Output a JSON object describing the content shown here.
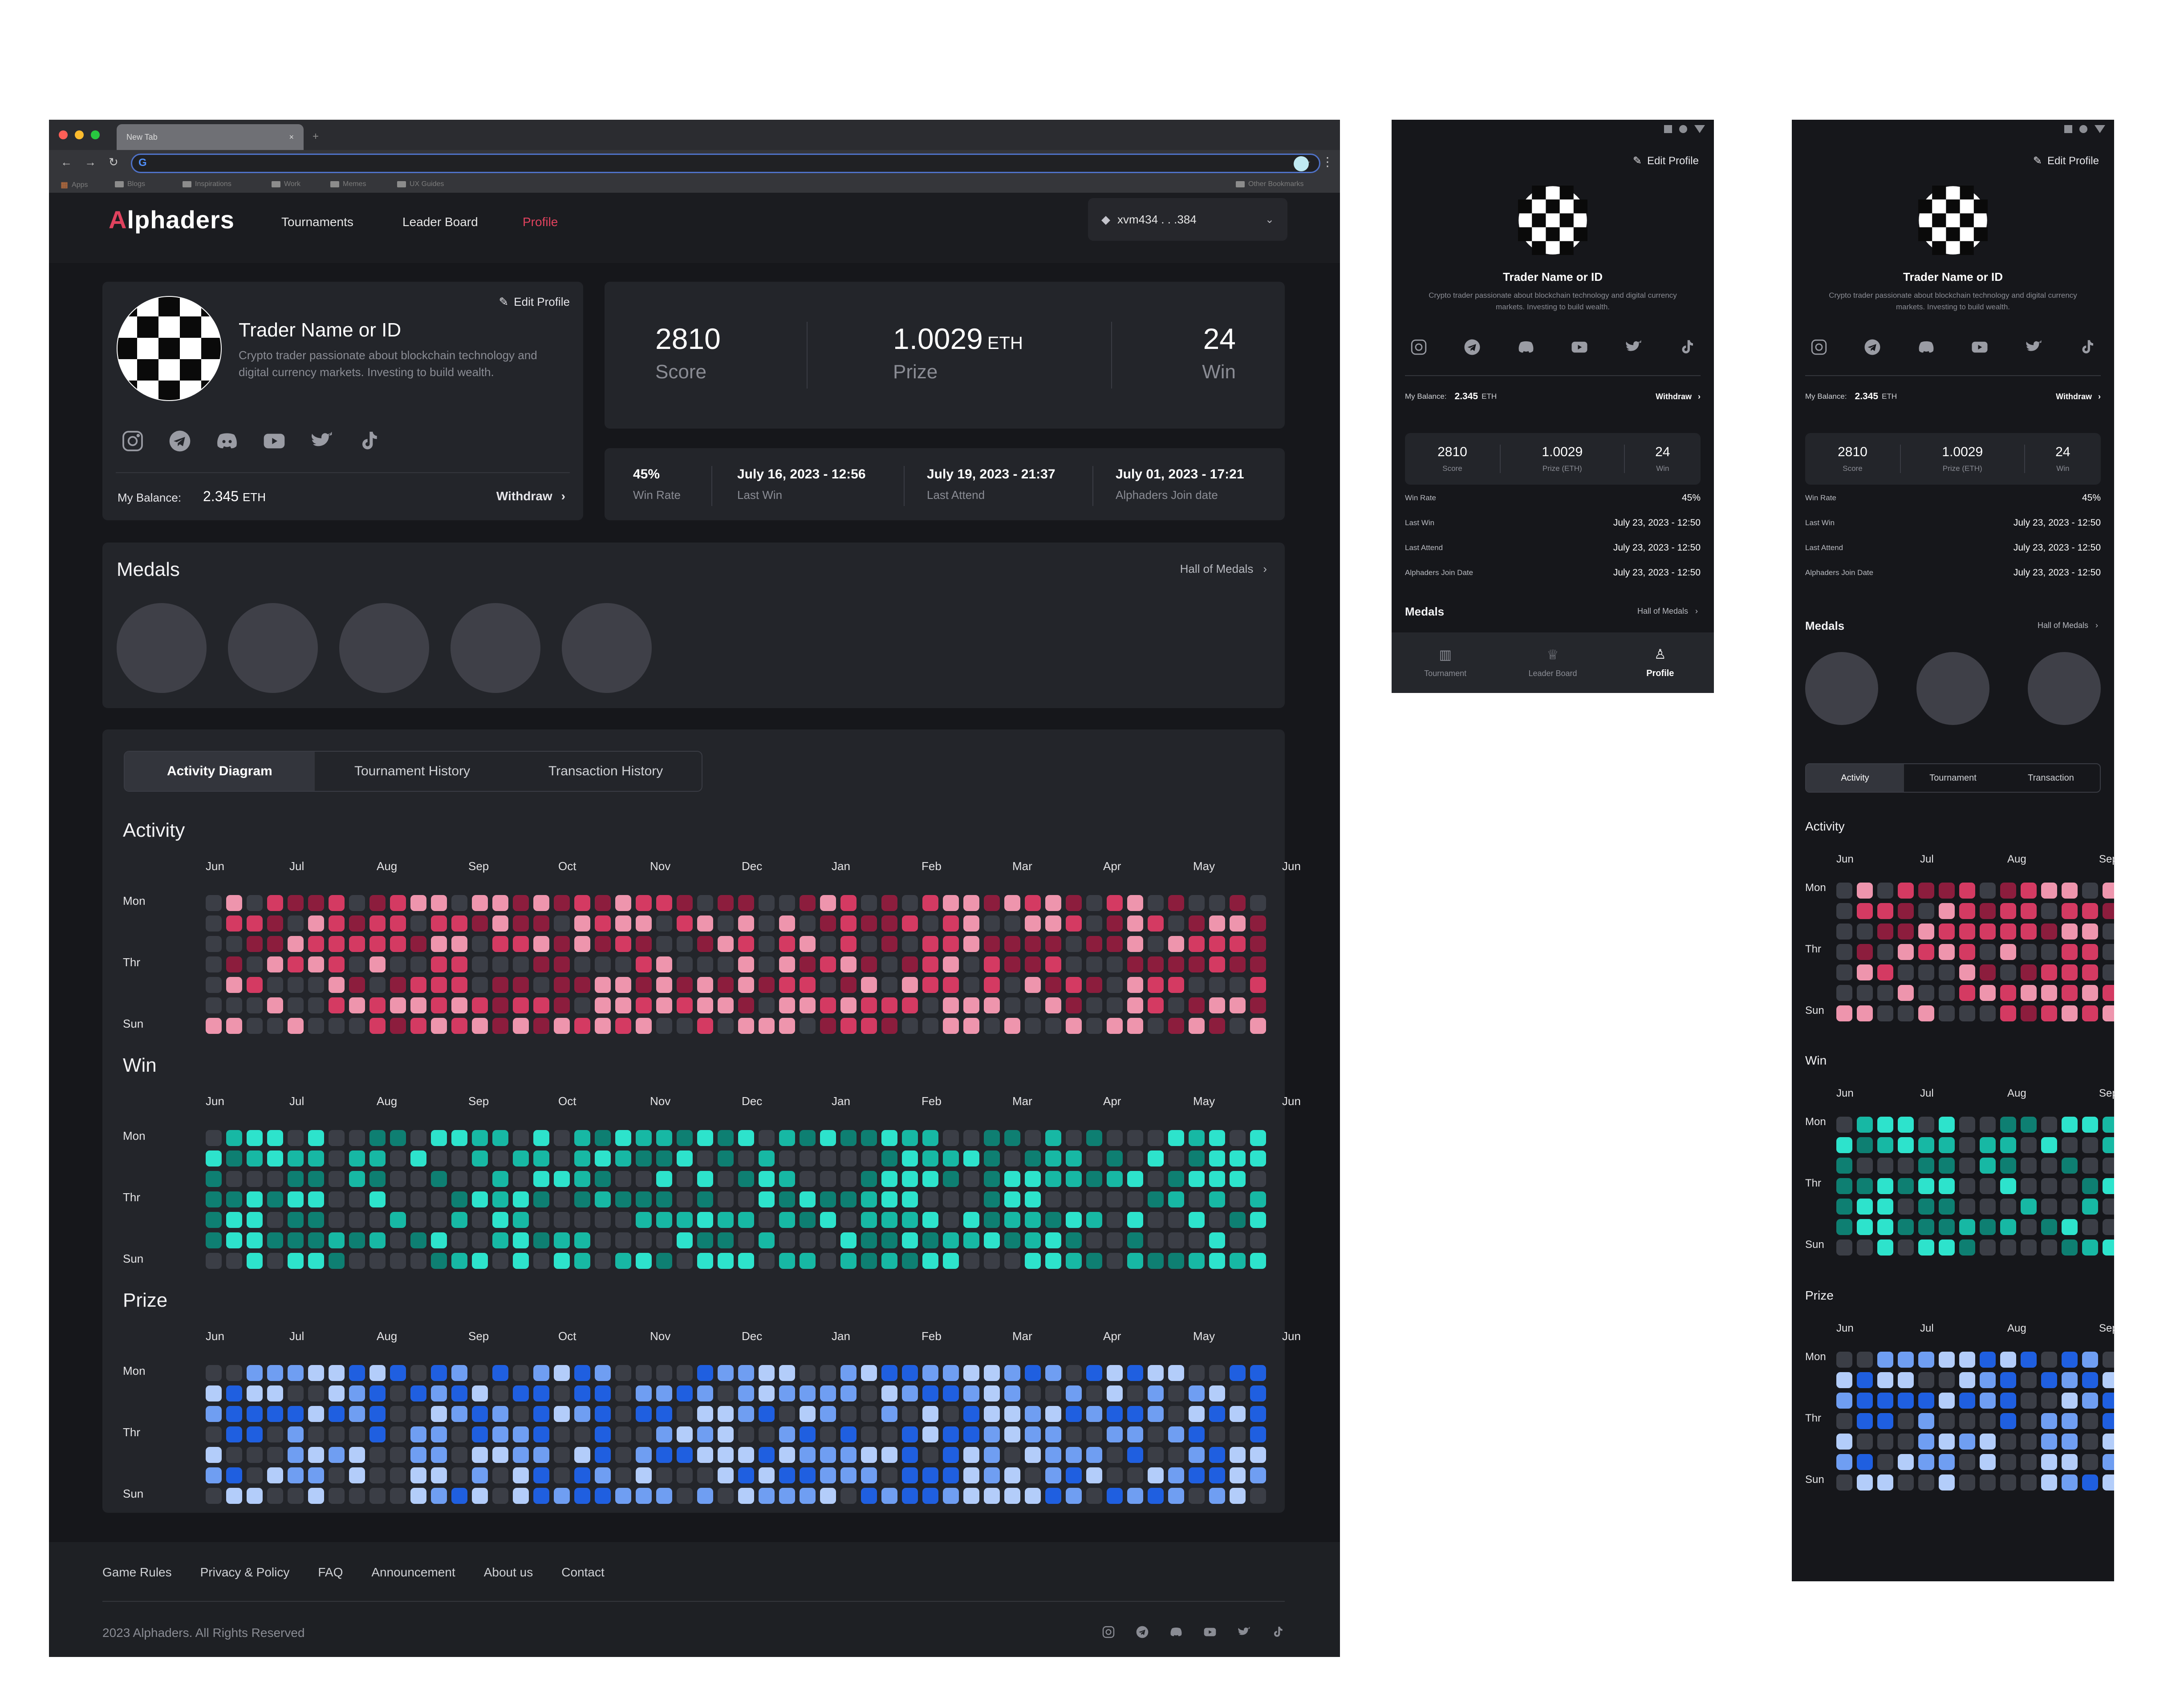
{
  "browser": {
    "tab_title": "New Tab",
    "tab_close": "×",
    "new_tab": "+",
    "bookmarks": [
      "Apps",
      "Blogs",
      "Inspirations",
      "Work",
      "Memes",
      "UX Guides"
    ],
    "other_bookmarks": "Other Bookmarks"
  },
  "nav": {
    "logo_a": "A",
    "logo_rest": "lphaders",
    "links": [
      "Tournaments",
      "Leader Board",
      "Profile"
    ],
    "active_color": "#e0425e",
    "wallet_address": "xvm434 . . .384"
  },
  "profile": {
    "name": "Trader Name or ID",
    "bio": "Crypto trader passionate about blockchain technology and digital currency markets. Investing to build wealth.",
    "edit_label": "Edit Profile",
    "balance_label": "My Balance:",
    "balance_value": "2.345",
    "balance_unit": "ETH",
    "withdraw_label": "Withdraw",
    "socials": [
      "instagram-icon",
      "telegram-icon",
      "discord-icon",
      "youtube-icon",
      "twitter-icon",
      "tiktok-icon"
    ]
  },
  "stats": {
    "score": "2810",
    "score_label": "Score",
    "prize": "1.0029",
    "prize_unit": "ETH",
    "prize_label": "Prize",
    "win": "24",
    "win_label": "Win"
  },
  "details": {
    "win_rate": "45%",
    "win_rate_label": "Win Rate",
    "last_win": "July 16, 2023 - 12:56",
    "last_win_label": "Last Win",
    "last_attend": "July 19, 2023 - 21:37",
    "last_attend_label": "Last Attend",
    "join_date": "July 01, 2023 - 17:21",
    "join_label": "Alphaders Join date"
  },
  "medals": {
    "title": "Medals",
    "hall_label": "Hall of Medals"
  },
  "activity_tabs": [
    "Activity Diagram",
    "Tournament History",
    "Transaction History"
  ],
  "heatmaps": {
    "months": [
      "Jun",
      "Jul",
      "Aug",
      "Sep",
      "Oct",
      "Nov",
      "Dec",
      "Jan",
      "Feb",
      "Mar",
      "Apr",
      "May",
      "Jun"
    ],
    "days": [
      "Mon",
      "Thr",
      "Sun"
    ],
    "sections": [
      {
        "title": "Activity",
        "palette": [
          "#3b3e46",
          "#8c1d3d",
          "#d43a62",
          "#ee95ad"
        ]
      },
      {
        "title": "Win",
        "palette": [
          "#3b3e46",
          "#0e7f72",
          "#17b8a4",
          "#2de3cc"
        ]
      },
      {
        "title": "Prize",
        "palette": [
          "#3b3e46",
          "#1f5fe0",
          "#6f9ef2",
          "#b3cdfa"
        ]
      }
    ]
  },
  "footer": {
    "links": [
      "Game Rules",
      "Privacy & Policy",
      "FAQ",
      "Announcement",
      "About us",
      "Contact"
    ],
    "copyright": "2023 Alphaders. All Rights Reserved"
  },
  "mobile": {
    "edit_label": "Edit Profile",
    "name": "Trader Name or ID",
    "bio": "Crypto trader passionate about blockchain technology and digital currency markets. Investing to build wealth.",
    "balance_label": "My Balance:",
    "balance_value": "2.345",
    "balance_unit": "ETH",
    "withdraw_label": "Withdraw",
    "score": "2810",
    "score_label": "Score",
    "prize": "1.0029",
    "prize_label": "Prize (ETH)",
    "win": "24",
    "win_label": "Win",
    "rows": [
      {
        "label": "Win Rate",
        "value": "45%"
      },
      {
        "label": "Last Win",
        "value": "July 23, 2023 - 12:50"
      },
      {
        "label": "Last Attend",
        "value": "July 23, 2023 - 12:50"
      },
      {
        "label": "Alphaders Join Date",
        "value": "July 23, 2023 - 12:50"
      }
    ],
    "medals_title": "Medals",
    "hall_label": "Hall of Medals",
    "bottom_nav": [
      "Tournament",
      "Leader Board",
      "Profile"
    ],
    "tabs": [
      "Activity",
      "Tournament",
      "Transaction"
    ],
    "months": [
      "Jun",
      "Jul",
      "Aug",
      "Sep"
    ],
    "section_titles": [
      "Activity",
      "Win",
      "Prize"
    ]
  }
}
